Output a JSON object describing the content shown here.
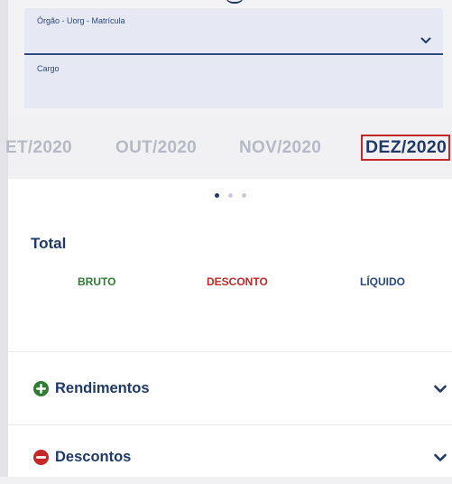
{
  "filters": {
    "orgao_label": "Órgão - Uorg - Matrícula",
    "cargo_label": "Cargo"
  },
  "months": [
    {
      "label": "ET/2020",
      "selected": false
    },
    {
      "label": "OUT/2020",
      "selected": false
    },
    {
      "label": "NOV/2020",
      "selected": false
    },
    {
      "label": "DEZ/2020",
      "selected": true
    }
  ],
  "pager": {
    "count": 3,
    "active": 1
  },
  "total": {
    "title": "Total",
    "bruto_label": "BRUTO",
    "desconto_label": "DESCONTO",
    "liquido_label": "LÍQUIDO"
  },
  "sections": {
    "rendimentos": "Rendimentos",
    "descontos": "Descontos"
  },
  "icons": {
    "rendimentos": "plus-circle-icon",
    "descontos": "minus-circle-icon",
    "expand": "chevron-down-icon"
  },
  "colors": {
    "primary": "#1f3a68",
    "green": "#2e7d32",
    "red": "#c62828",
    "field_bg": "#e6e8f3",
    "inactive_month": "#b6bac6"
  }
}
